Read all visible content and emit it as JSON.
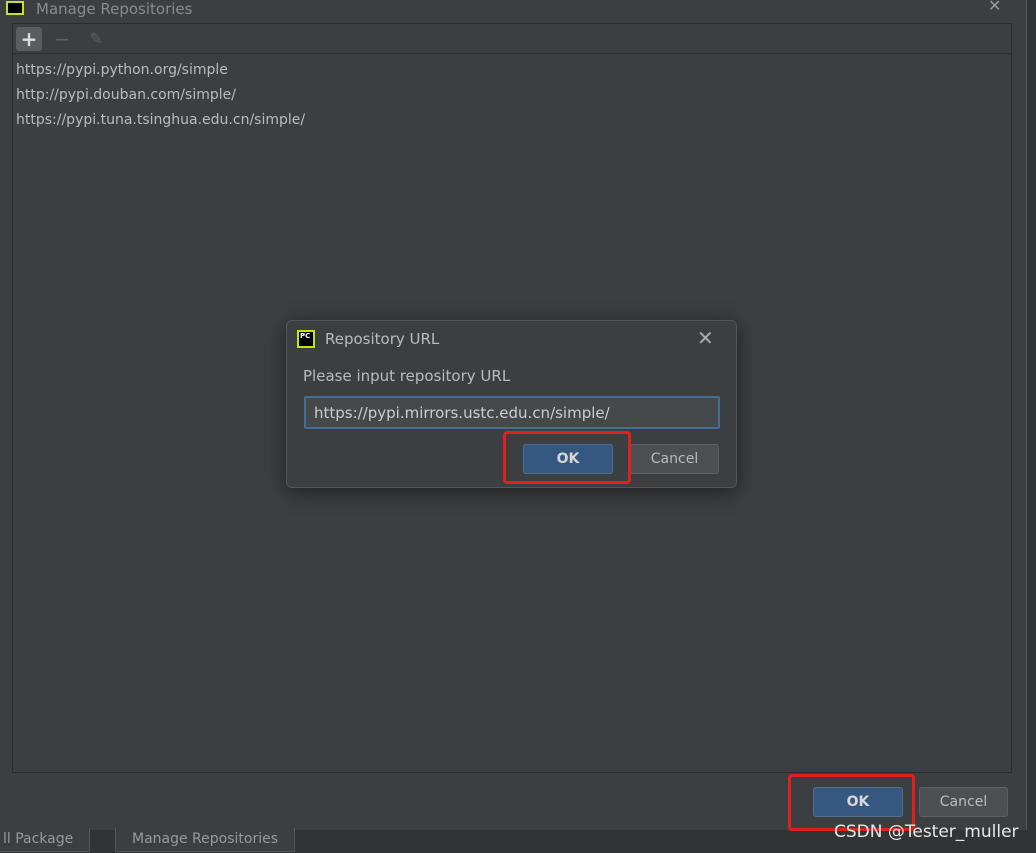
{
  "window": {
    "title": "Manage Repositories",
    "close_icon": "close-icon"
  },
  "toolbar": {
    "add": "+",
    "remove": "−",
    "edit": "✎"
  },
  "repositories": [
    "https://pypi.python.org/simple",
    "http://pypi.douban.com/simple/",
    "https://pypi.tuna.tsinghua.edu.cn/simple/"
  ],
  "dialog": {
    "title": "Repository URL",
    "icon_text": "PC",
    "prompt": "Please input repository URL",
    "url_value": "https://pypi.mirrors.ustc.edu.cn/simple/",
    "ok": "OK",
    "cancel": "Cancel"
  },
  "footer": {
    "ok": "OK",
    "cancel": "Cancel"
  },
  "bottom_tabs": [
    "ll Package",
    "Manage Repositories"
  ],
  "watermark": "CSDN @Tester_muller",
  "colors": {
    "highlight": "#e0201c",
    "accent": "#365880"
  }
}
